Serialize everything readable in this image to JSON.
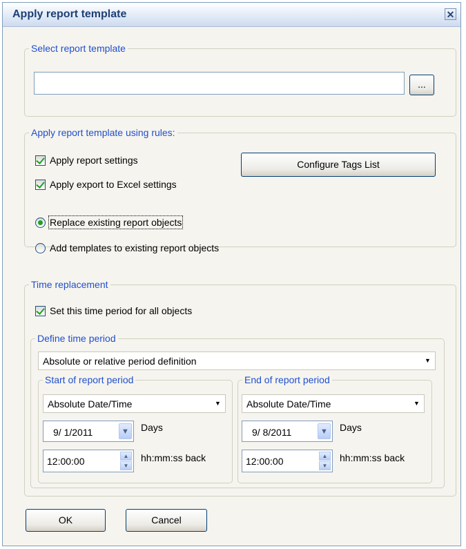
{
  "window": {
    "title": "Apply report template",
    "close_glyph": "✕"
  },
  "select_template": {
    "legend": "Select report template",
    "path_value": "",
    "browse_label": "..."
  },
  "rules": {
    "legend": "Apply report template using rules:",
    "apply_report_settings": {
      "label": "Apply report settings",
      "checked": true
    },
    "apply_excel_settings": {
      "label": "Apply export to Excel settings",
      "checked": true
    },
    "configure_tags_label": "Configure Tags List",
    "replace_objects": {
      "label": "Replace existing report objects",
      "selected": true
    },
    "add_templates": {
      "label": "Add templates to existing report objects",
      "selected": false
    }
  },
  "time": {
    "legend": "Time replacement",
    "set_period": {
      "label": "Set this time period for all objects",
      "checked": true
    },
    "define": {
      "legend": "Define time period",
      "mode_value": "Absolute or relative period definition"
    },
    "start": {
      "legend": "Start of report period",
      "type_value": "Absolute Date/Time",
      "date_value": "9/ 1/2011",
      "days_label": "Days",
      "time_value": "12:00:00",
      "time_unit_label": "hh:mm:ss back"
    },
    "end": {
      "legend": "End of report period",
      "type_value": "Absolute Date/Time",
      "date_value": "9/ 8/2011",
      "days_label": "Days",
      "time_value": "12:00:00",
      "time_unit_label": "hh:mm:ss back"
    }
  },
  "buttons": {
    "ok_label": "OK",
    "cancel_label": "Cancel"
  },
  "colors": {
    "legend_text": "#1f4fcc",
    "check_mark": "#21a121",
    "title_text": "#1f3f74"
  }
}
